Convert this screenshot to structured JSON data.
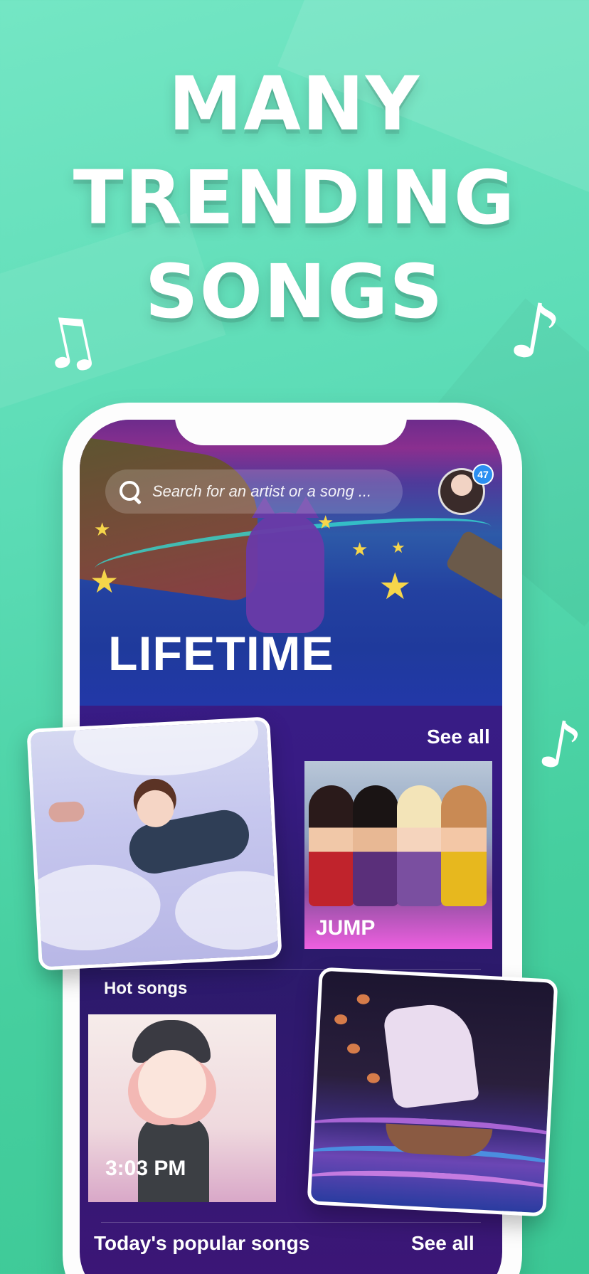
{
  "headline": {
    "line1": "MANY",
    "line2": "TRENDING",
    "line3": "SONGS"
  },
  "music_notes": {
    "left": "♫",
    "right": "♪",
    "mid": "♪"
  },
  "search": {
    "placeholder": "Search for an artist or a song ..."
  },
  "profile": {
    "badge_count": "47"
  },
  "hero": {
    "title": "LIFETIME"
  },
  "section_top": {
    "see_all": "See all"
  },
  "cards": {
    "jump": {
      "title": "JUMP"
    },
    "time": {
      "title": "3:03 PM"
    }
  },
  "hot_songs": {
    "label": "Hot songs"
  },
  "popular": {
    "label": "Today's popular songs",
    "see_all": "See all"
  },
  "colors": {
    "background": "#5cdcb6",
    "accent_badge": "#2b8ff1",
    "screen": "#3a1f8a",
    "jump_pink": "#ee5fe0"
  }
}
